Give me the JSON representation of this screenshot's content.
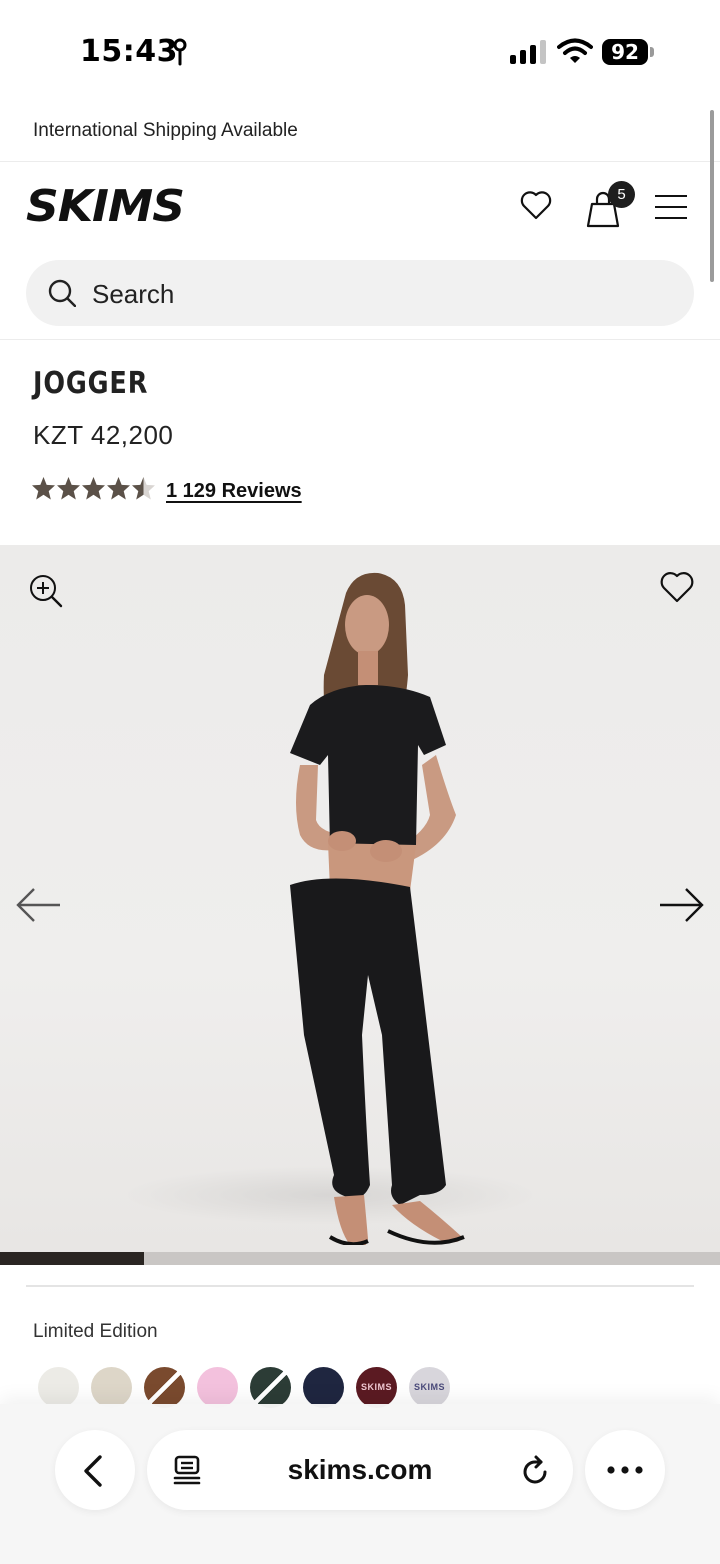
{
  "status_bar": {
    "time": "15:43",
    "battery": "92",
    "icons": [
      "location-icon",
      "signal-icon",
      "wifi-icon",
      "battery-icon"
    ]
  },
  "banner": {
    "text": "International Shipping Available"
  },
  "header": {
    "logo": "SKIMS",
    "bag_count": "5",
    "icons": [
      "heart-icon",
      "bag-icon",
      "menu-icon"
    ]
  },
  "search": {
    "placeholder": "Search"
  },
  "product": {
    "title": "JOGGER",
    "price": "KZT 42,200",
    "rating": 4.5,
    "rating_max": 5,
    "reviews_label": "1 129 Reviews"
  },
  "gallery": {
    "progress": 0.2,
    "icons": [
      "zoom-in-icon",
      "heart-icon",
      "arrow-left-icon",
      "arrow-right-icon"
    ]
  },
  "limited": {
    "label": "Limited Edition",
    "swatches": [
      {
        "color": "#ecebe6",
        "text": ""
      },
      {
        "color": "#ddd6c8",
        "text": ""
      },
      {
        "color": "#7a4a2e",
        "text": ""
      },
      {
        "color": "#f3c1dd",
        "text": ""
      },
      {
        "color": "#2c3c36",
        "text": ""
      },
      {
        "color": "#1f2640",
        "text": ""
      },
      {
        "color": "#5b1a22",
        "text": "SKIMS"
      },
      {
        "color": "#d8d6dc",
        "text": "SKIMS"
      }
    ]
  },
  "browser": {
    "url": "skims.com"
  },
  "colors": {
    "accent": "#1e1e1e",
    "star": "#5b5148",
    "page_bg": "#ffffff"
  }
}
